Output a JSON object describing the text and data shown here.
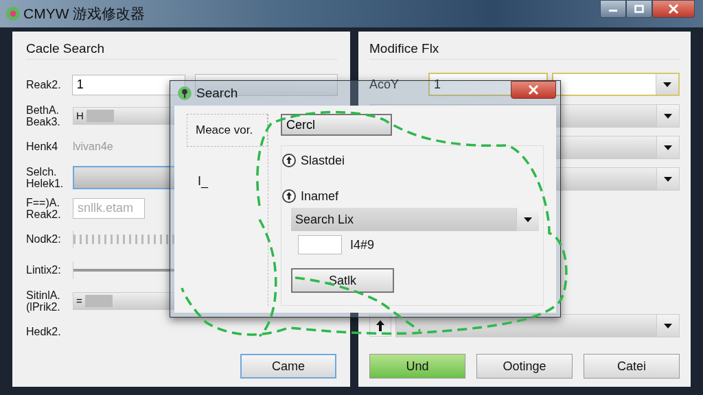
{
  "window": {
    "title": "CMYW 游戏修改器"
  },
  "left_panel": {
    "title": "Cacle Search",
    "rows": [
      {
        "kind": "input-pair",
        "label": "Reak2.",
        "value": "1"
      },
      {
        "kind": "bar",
        "label": "BethA. Beak3.",
        "value": "H"
      },
      {
        "kind": "hint",
        "label": "Henk4",
        "value": "lvivan4e"
      },
      {
        "kind": "focus-bar",
        "label": "Selch. Helek1."
      },
      {
        "kind": "input",
        "label": "F==)A. Reak2.",
        "placeholder": "snllk.etam"
      },
      {
        "kind": "ticks",
        "label": "Nodk2:",
        "level": 1
      },
      {
        "kind": "track",
        "label": "Lintix2:",
        "level": 1
      },
      {
        "kind": "bar",
        "label": "SitinlA. (lPrik2.",
        "value": "="
      },
      {
        "kind": "none",
        "label": "Hedk2."
      }
    ],
    "button": "Came"
  },
  "right_panel": {
    "title": "Modifice Flx",
    "rows": [
      {
        "kind": "combo",
        "label": "AcoY",
        "value": "1",
        "focused": true
      },
      {
        "kind": "combo",
        "focused": false
      },
      {
        "kind": "combo",
        "focused": false
      },
      {
        "kind": "combo",
        "focused": false
      },
      {
        "kind": "arrow-combo",
        "focused": false
      }
    ],
    "buttons": [
      {
        "label": "Und",
        "default": true
      },
      {
        "label": "Ootinge",
        "default": false
      },
      {
        "label": "Catei",
        "default": false
      }
    ]
  },
  "dialog": {
    "title": "Search",
    "label": "Meace vor.",
    "note": "I_",
    "field": "Cercl",
    "options": [
      {
        "label": "Slastdei"
      },
      {
        "label": "Inamef"
      }
    ],
    "combo": "Search Lix",
    "code": "I4#9",
    "button": "Satlk"
  }
}
